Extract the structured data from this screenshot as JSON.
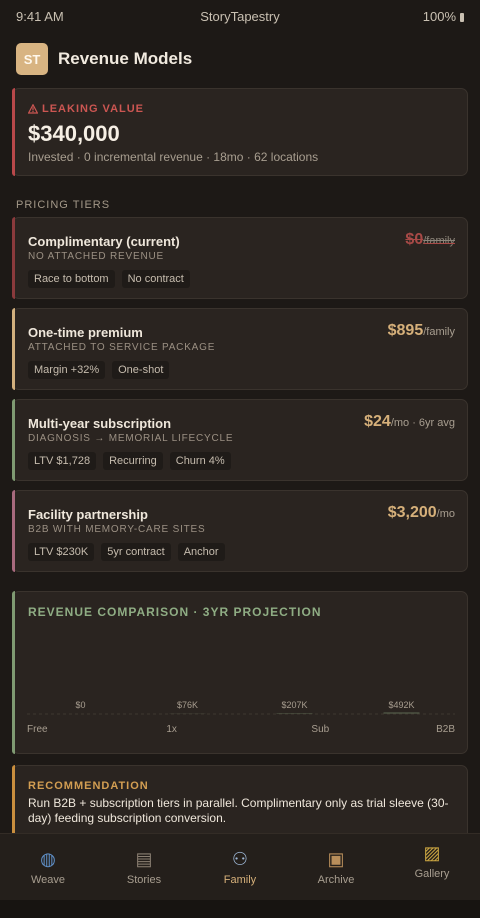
{
  "status_bar": {
    "time": "9:41 AM",
    "app": "StoryTapestry",
    "battery": "100%"
  },
  "header": {
    "logo_text": "ST",
    "title": "Revenue Models"
  },
  "alert": {
    "label": "LEAKING VALUE",
    "value": "$340,000",
    "detail": "Invested · 0 incremental revenue · 18mo · 62 locations",
    "accent": "#b8484a"
  },
  "section_label": "PRICING TIERS",
  "tiers": [
    {
      "name": "Complimentary (current)",
      "subtitle": "NO ATTACHED REVENUE",
      "price": "$0",
      "unit": "/family",
      "tags": [
        "Race to bottom",
        "No contract"
      ],
      "accent": "#8a3a3c"
    },
    {
      "name": "One-time premium",
      "subtitle": "ATTACHED TO SERVICE PACKAGE",
      "price": "$895",
      "unit": "/family",
      "tags": [
        "Margin +32%",
        "One-shot"
      ],
      "accent": "#d2b07e"
    },
    {
      "name": "Multi-year subscription",
      "subtitle": "DIAGNOSIS → MEMORIAL LIFECYCLE",
      "price": "$24",
      "unit": "/mo · 6yr avg",
      "tags": [
        "LTV $1,728",
        "Recurring",
        "Churn 4%"
      ],
      "accent": "#7f9a72"
    },
    {
      "name": "Facility partnership",
      "subtitle": "B2B WITH MEMORY-CARE SITES",
      "price": "$3,200",
      "unit": "/mo",
      "tags": [
        "LTV $230K",
        "5yr contract",
        "Anchor"
      ],
      "accent": "#a86a7e"
    }
  ],
  "chart_data": {
    "type": "bar",
    "title": "REVENUE COMPARISON · 3YR PROJECTION",
    "categories": [
      "Free",
      "1x",
      "Sub",
      "B2B"
    ],
    "values": [
      0,
      76000,
      207000,
      492000
    ],
    "value_labels": [
      "$0",
      "$76K",
      "$207K",
      "$492K"
    ],
    "xlabel": "",
    "ylabel": "",
    "grid": false,
    "accent": "#8fad84"
  },
  "recommendation": {
    "title": "RECOMMENDATION",
    "text": "Run B2B + subscription tiers in parallel. Complimentary only as trial sleeve (30-day) feeding subscription conversion."
  },
  "tabs": [
    {
      "label": "Weave",
      "icon": "spool-icon",
      "glyph": "◍",
      "active": false
    },
    {
      "label": "Stories",
      "icon": "book-icon",
      "glyph": "▤",
      "active": false
    },
    {
      "label": "Family",
      "icon": "family-icon",
      "glyph": "⚇",
      "active": true
    },
    {
      "label": "Archive",
      "icon": "package-icon",
      "glyph": "▣",
      "active": false
    },
    {
      "label": "Gallery",
      "icon": "framed-picture-icon",
      "glyph": "▨",
      "active": false
    }
  ]
}
